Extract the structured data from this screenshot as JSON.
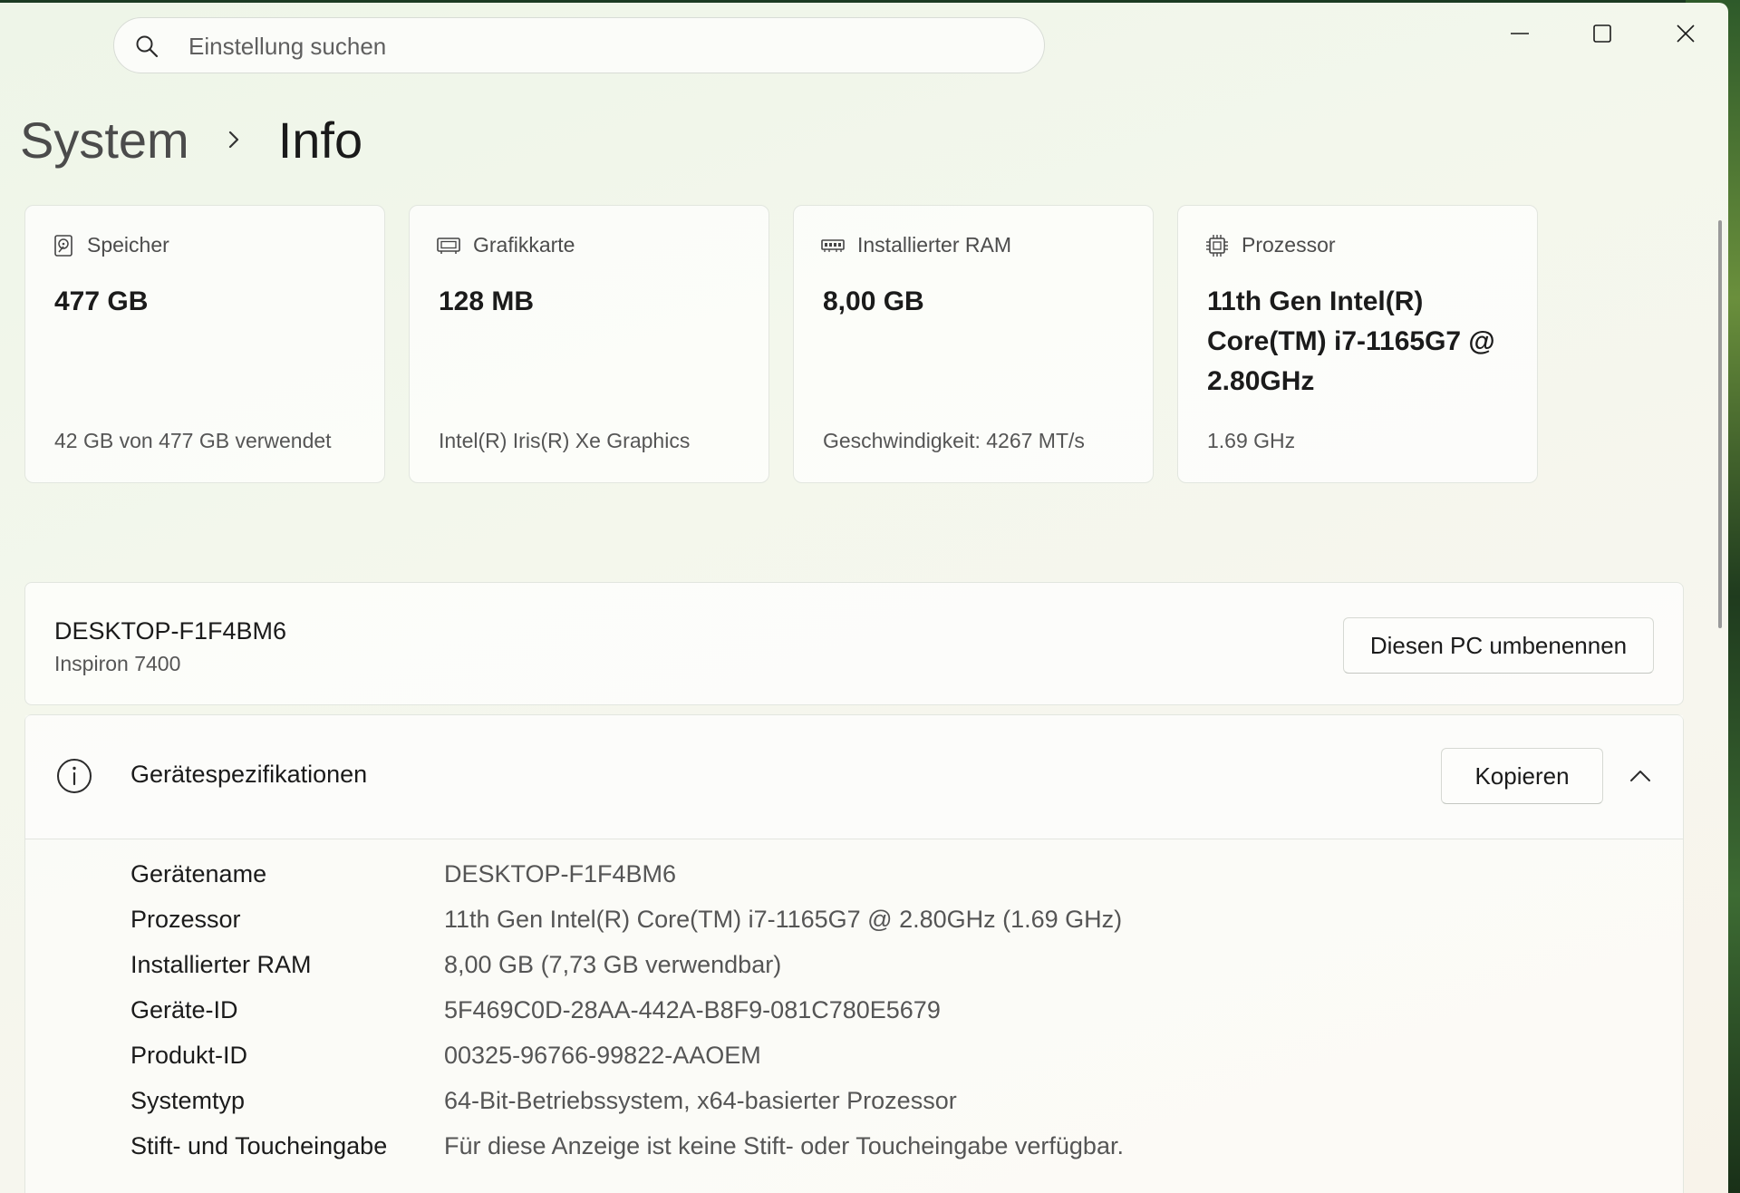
{
  "search": {
    "placeholder": "Einstellung suchen"
  },
  "breadcrumb": {
    "parent": "System",
    "current": "Info"
  },
  "cards": [
    {
      "icon": "storage-icon",
      "title": "Speicher",
      "value": "477 GB",
      "sub": "42 GB von 477 GB verwendet"
    },
    {
      "icon": "graphics-card-icon",
      "title": "Grafikkarte",
      "value": "128 MB",
      "sub": "Intel(R) Iris(R) Xe Graphics"
    },
    {
      "icon": "ram-icon",
      "title": "Installierter RAM",
      "value": "8,00 GB",
      "sub": "Geschwindigkeit: 4267 MT/s"
    },
    {
      "icon": "processor-icon",
      "title": "Prozessor",
      "value": "11th Gen Intel(R) Core(TM) i7-1165G7 @ 2.80GHz",
      "sub": "1.69 GHz"
    }
  ],
  "pc": {
    "name": "DESKTOP-F1F4BM6",
    "model": "Inspiron 7400",
    "rename_label": "Diesen PC umbenennen"
  },
  "specs": {
    "title": "Gerätespezifikationen",
    "copy_label": "Kopieren",
    "rows": [
      {
        "label": "Gerätename",
        "value": "DESKTOP-F1F4BM6"
      },
      {
        "label": "Prozessor",
        "value": "11th Gen Intel(R) Core(TM) i7-1165G7 @ 2.80GHz (1.69 GHz)"
      },
      {
        "label": "Installierter RAM",
        "value": "8,00 GB (7,73 GB verwendbar)"
      },
      {
        "label": "Geräte-ID",
        "value": "5F469C0D-28AA-442A-B8F9-081C780E5679"
      },
      {
        "label": "Produkt-ID",
        "value": "00325-96766-99822-AAOEM"
      },
      {
        "label": "Systemtyp",
        "value": "64-Bit-Betriebssystem, x64-basierter Prozessor"
      },
      {
        "label": "Stift- und Toucheingabe",
        "value": "Für diese Anzeige ist keine Stift- oder Toucheingabe verfügbar."
      }
    ]
  }
}
